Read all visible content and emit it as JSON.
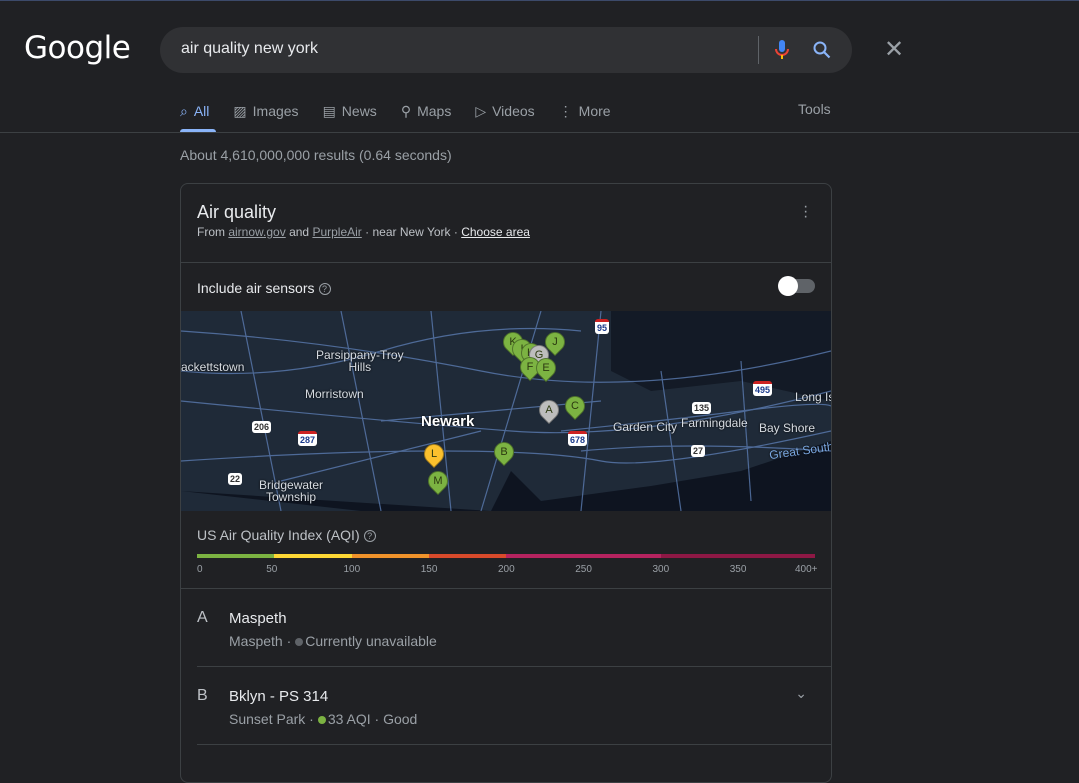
{
  "logo": "Google",
  "search": {
    "query": "air quality new york",
    "clear_icon": "close-icon",
    "mic_icon": "mic-icon",
    "search_icon": "search-icon"
  },
  "tabs": [
    {
      "label": "All",
      "icon": "search-icon",
      "active": true
    },
    {
      "label": "Images",
      "icon": "image-icon"
    },
    {
      "label": "News",
      "icon": "news-icon"
    },
    {
      "label": "Maps",
      "icon": "map-pin-icon"
    },
    {
      "label": "Videos",
      "icon": "play-icon"
    },
    {
      "label": "More",
      "icon": "kebab-icon"
    }
  ],
  "tools": "Tools",
  "stats": "About 4,610,000,000 results (0.64 seconds)",
  "card": {
    "title": "Air quality",
    "from": "From",
    "src1": "airnow.gov",
    "and": "and",
    "src2": "PurpleAir",
    "near": "· near New York ·",
    "choose": "Choose area",
    "sensors_label": "Include air sensors",
    "sensors_on": false,
    "map": {
      "places": [
        "ackettstown",
        "Parsippany-Troy Hills",
        "Morristown",
        "Newark",
        "Garden City",
        "Farmingdale",
        "Bay Shore",
        "Long Is",
        "Great South B",
        "Bridgewater Township"
      ],
      "shields": [
        "95",
        "495",
        "135",
        "678",
        "27",
        "206",
        "287",
        "22"
      ],
      "markers": [
        {
          "letter": "K",
          "color": "#7cb342"
        },
        {
          "letter": "I",
          "color": "#7cb342"
        },
        {
          "letter": "H",
          "color": "#7cb342"
        },
        {
          "letter": "G",
          "color": "#bdbdbd"
        },
        {
          "letter": "J",
          "color": "#7cb342"
        },
        {
          "letter": "F",
          "color": "#7cb342"
        },
        {
          "letter": "E",
          "color": "#7cb342"
        },
        {
          "letter": "A",
          "color": "#bdbdbd"
        },
        {
          "letter": "C",
          "color": "#7cb342"
        },
        {
          "letter": "B",
          "color": "#7cb342"
        },
        {
          "letter": "L",
          "color": "#fbc02d"
        },
        {
          "letter": "M",
          "color": "#7cb342"
        }
      ]
    },
    "aqi_label": "US Air Quality Index (AQI)",
    "scale": {
      "ticks": [
        "0",
        "50",
        "100",
        "150",
        "200",
        "250",
        "300",
        "350",
        "400+"
      ],
      "colors": [
        "#7cb342",
        "#fdd835",
        "#f0932b",
        "#d84a2b",
        "#b5235f",
        "#8e1845"
      ]
    },
    "stations": [
      {
        "letter": "A",
        "name": "Maspeth",
        "area": "Maspeth",
        "status": "Currently unavailable",
        "dot": "#5f6368"
      },
      {
        "letter": "B",
        "name": "Bklyn - PS 314",
        "area": "Sunset Park",
        "status": "33 AQI",
        "category": "Good",
        "dot": "#7cb342"
      }
    ]
  }
}
